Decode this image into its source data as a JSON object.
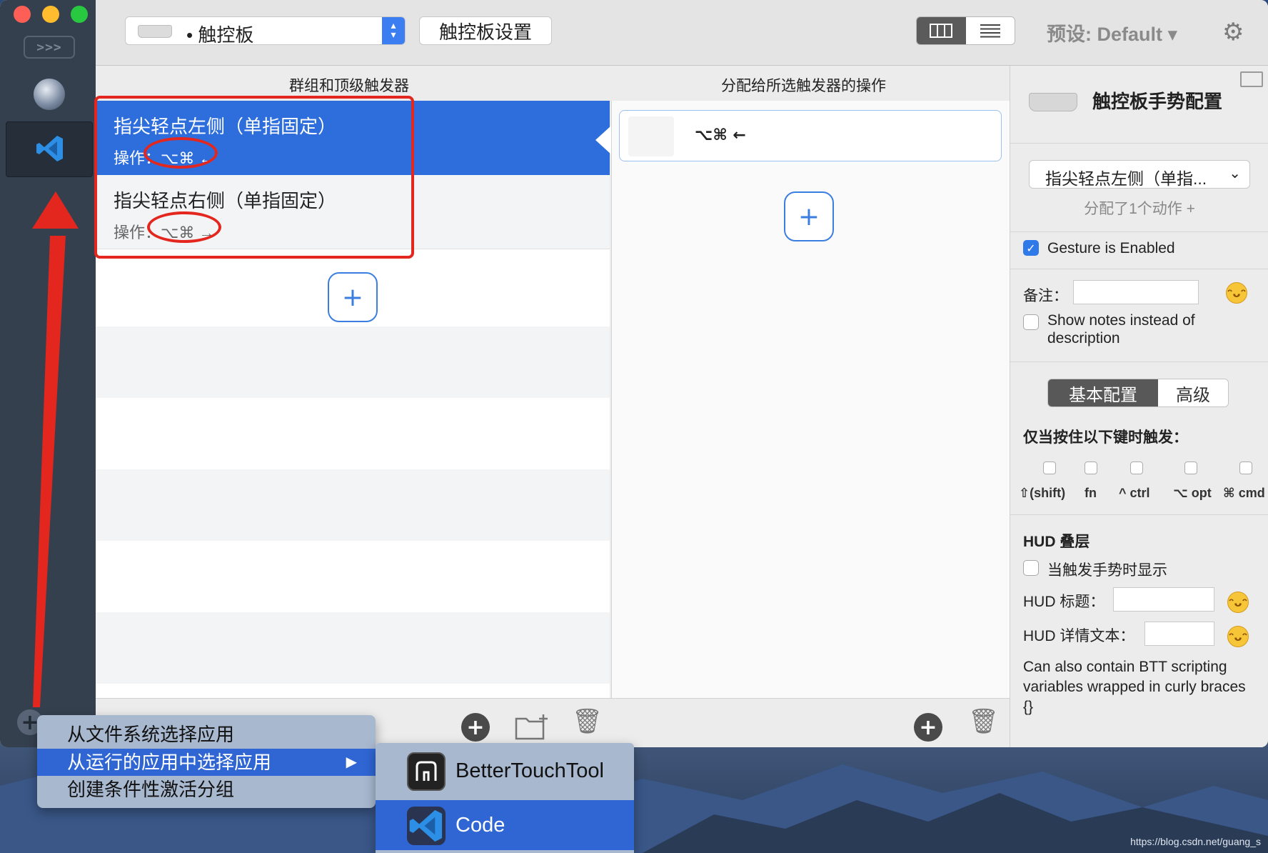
{
  "toolbar": {
    "device_selector": "• 触控板",
    "settings_button": "触控板设置",
    "preset_label": "预设: Default ▾"
  },
  "columns": {
    "left_header": "群组和顶级触发器",
    "middle_header": "分配给所选触发器的操作"
  },
  "sidebar": {
    "expand_label": ">>>"
  },
  "triggers": [
    {
      "title": "指尖轻点左侧（单指固定）",
      "subtitle": "操作：⌥⌘ ←",
      "selected": true
    },
    {
      "title": "指尖轻点右侧（单指固定）",
      "subtitle": "操作：⌥⌘ →",
      "selected": false
    }
  ],
  "actions": [
    {
      "keys": "⌥⌘ ←"
    }
  ],
  "inspector": {
    "title": "触控板手势配置",
    "gesture_select": "指尖轻点左侧（单指...",
    "assigned_text": "分配了1个动作 +",
    "gesture_enabled": "Gesture is Enabled",
    "notes_label": "备注：",
    "show_notes": "Show notes instead of description",
    "tab_basic": "基本配置",
    "tab_advanced": "高级",
    "only_when_keys": "仅当按住以下键时触发：",
    "modifiers": [
      "⇧(shift)",
      "fn",
      "^ ctrl",
      "⌥ opt",
      "⌘ cmd"
    ],
    "hud_section": "HUD 叠层",
    "hud_show": "当触发手势时显示",
    "hud_title": "HUD 标题：",
    "hud_detail": "HUD 详情文本：",
    "btt_note": "Can also contain BTT scripting variables wrapped in curly braces {}"
  },
  "context_menu": {
    "items": [
      "从文件系统选择应用",
      "从运行的应用中选择应用",
      "创建条件性激活分组"
    ],
    "submenu": [
      "BetterTouchTool",
      "Code"
    ]
  },
  "watermark": "https://blog.csdn.net/guang_s",
  "colors": {
    "selection_blue": "#2e6edc",
    "annotation_red": "#e3271e",
    "menu_highlight": "#2f66d4"
  }
}
